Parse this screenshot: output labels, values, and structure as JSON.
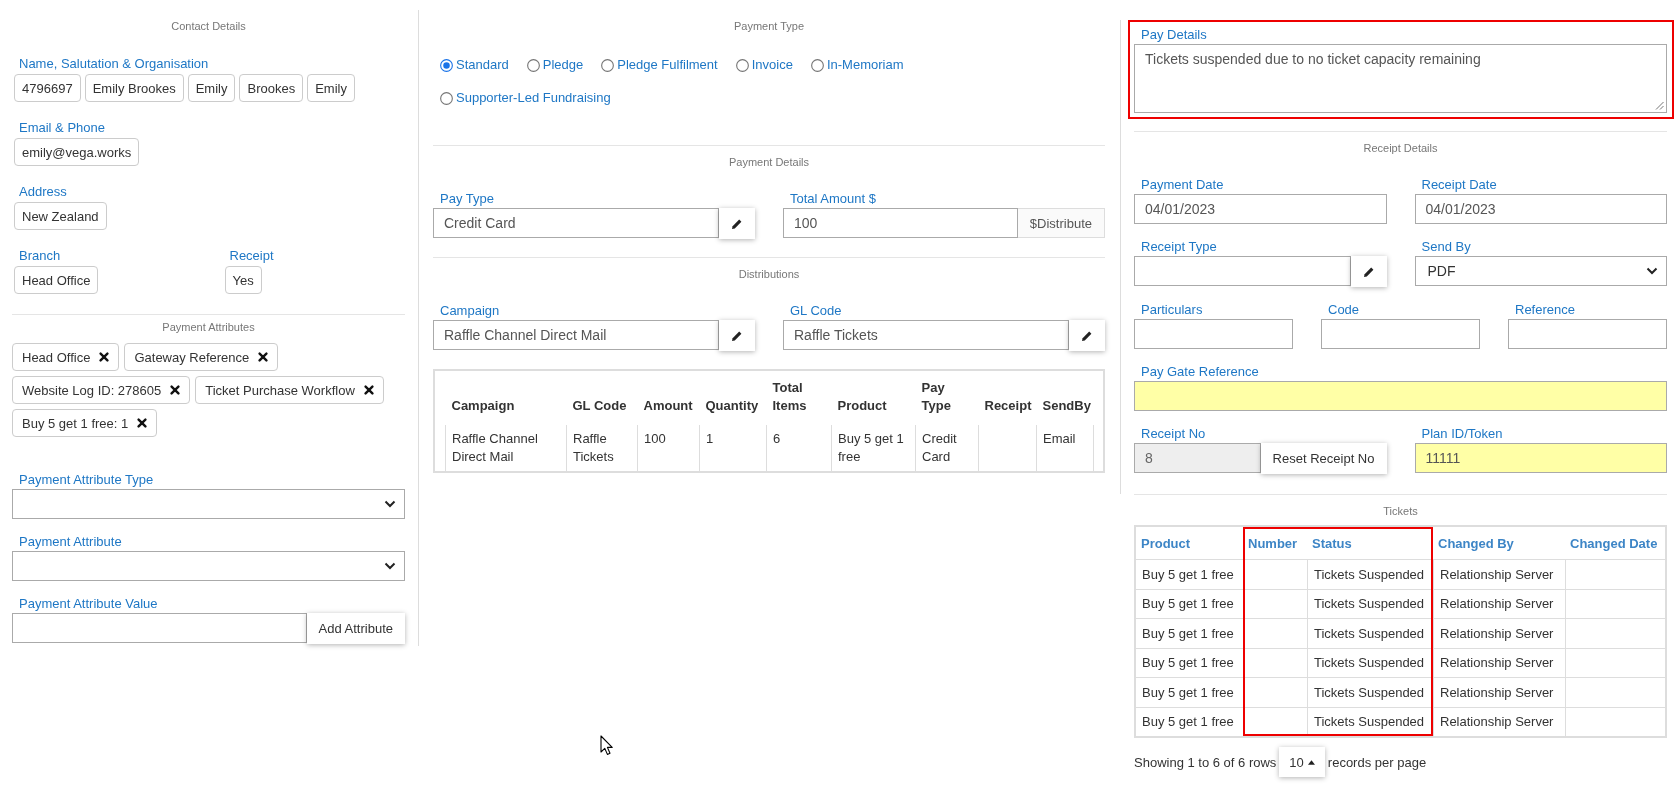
{
  "contact_details": {
    "title": "Contact Details",
    "rows": [
      [
        {
          "kind": "chips",
          "label": "Name, Salutation & Organisation",
          "values": [
            "4796697",
            "Emily Brookes",
            "Emily",
            "Brookes",
            "Emily"
          ]
        }
      ],
      [
        {
          "kind": "chips",
          "label": "Email & Phone",
          "values": [
            "emily@vega.works"
          ]
        }
      ],
      [
        {
          "kind": "chips",
          "label": "Address",
          "values": [
            "New Zealand"
          ]
        }
      ],
      [
        {
          "kind": "chips",
          "label": "Branch",
          "values": [
            "Head Office"
          ]
        },
        {
          "kind": "chips",
          "label": "Receipt",
          "values": [
            "Yes"
          ]
        }
      ]
    ]
  },
  "payment_attributes": {
    "title": "Payment Attributes",
    "tags": [
      "Head Office",
      "Gateway Reference",
      "Website Log ID: 278605",
      "Ticket Purchase Workflow",
      "Buy 5 get 1 free: 1"
    ],
    "rows": [
      [
        {
          "kind": "select",
          "label": "Payment Attribute Type"
        }
      ],
      [
        {
          "kind": "select",
          "label": "Payment Attribute"
        }
      ],
      [
        {
          "kind": "action",
          "label": "Payment Attribute Value",
          "button": "Add Attribute",
          "disabled": false
        }
      ]
    ]
  },
  "payment_type": {
    "title": "Payment Type",
    "options": [
      {
        "label": "Standard",
        "selected": true
      },
      {
        "label": "Pledge",
        "selected": false
      },
      {
        "label": "Pledge Fulfilment",
        "selected": false
      },
      {
        "label": "Invoice",
        "selected": false
      },
      {
        "label": "In-Memoriam",
        "selected": false
      },
      {
        "label": "Supporter-Led Fundraising",
        "selected": false
      }
    ]
  },
  "payment_details": {
    "title": "Payment Details",
    "rows": [
      [
        {
          "kind": "lookup",
          "label": "Pay Type",
          "value": "Credit Card"
        },
        {
          "kind": "addon",
          "label": "Total Amount $",
          "value": "100",
          "addon": "$Distribute"
        }
      ]
    ]
  },
  "distributions": {
    "title": "Distributions",
    "rows": [
      [
        {
          "kind": "lookup",
          "label": "Campaign",
          "value": "Raffle Channel Direct Mail"
        },
        {
          "kind": "lookup",
          "label": "GL Code",
          "value": "Raffle Tickets"
        }
      ]
    ],
    "table": {
      "kind": "summary",
      "columns": [
        "Campaign",
        "GL Code",
        "Amount",
        "Quantity",
        "Total Items",
        "Product",
        "Pay Type",
        "Receipt",
        "SendBy"
      ],
      "rows": [
        [
          "Raffle Channel Direct Mail",
          "Raffle Tickets",
          "100",
          "1",
          "6",
          "Buy 5 get 1 free",
          "Credit Card",
          null,
          "Email"
        ]
      ]
    }
  },
  "pay_details": {
    "highlighted": true,
    "rows": [
      [
        {
          "kind": "textarea",
          "label": "Pay Details",
          "value": "Tickets suspended due to no ticket capacity remaining"
        }
      ]
    ]
  },
  "receipt_details": {
    "title": "Receipt Details",
    "rows": [
      [
        {
          "kind": "text",
          "label": "Payment Date",
          "value": "04/01/2023"
        },
        {
          "kind": "text",
          "label": "Receipt Date",
          "value": "04/01/2023"
        }
      ],
      [
        {
          "kind": "lookup",
          "label": "Receipt Type"
        },
        {
          "kind": "select",
          "label": "Send By",
          "value": "PDF"
        }
      ],
      [
        {
          "kind": "text",
          "label": "Particulars"
        },
        {
          "kind": "text",
          "label": "Code"
        },
        {
          "kind": "text",
          "label": "Reference"
        }
      ],
      [
        {
          "kind": "highlight",
          "label": "Pay Gate Reference"
        }
      ],
      [
        {
          "kind": "action",
          "label": "Receipt No",
          "value": "8",
          "button": "Reset Receipt No",
          "disabled": true
        },
        {
          "kind": "highlight",
          "label": "Plan ID/Token",
          "value": "11111"
        }
      ]
    ]
  },
  "tickets": {
    "title": "Tickets",
    "table": {
      "kind": "list",
      "columns": [
        {
          "label": "Product",
          "highlighted": false
        },
        {
          "label": "Number",
          "highlighted": true
        },
        {
          "label": "Status",
          "highlighted": true
        },
        {
          "label": "Changed By",
          "highlighted": false
        },
        {
          "label": "Changed Date",
          "highlighted": false
        }
      ],
      "rows": [
        [
          "Buy 5 get 1 free",
          null,
          "Tickets Suspended",
          "Relationship Server",
          null
        ],
        [
          "Buy 5 get 1 free",
          null,
          "Tickets Suspended",
          "Relationship Server",
          null
        ],
        [
          "Buy 5 get 1 free",
          null,
          "Tickets Suspended",
          "Relationship Server",
          null
        ],
        [
          "Buy 5 get 1 free",
          null,
          "Tickets Suspended",
          "Relationship Server",
          null
        ],
        [
          "Buy 5 get 1 free",
          null,
          "Tickets Suspended",
          "Relationship Server",
          null
        ],
        [
          "Buy 5 get 1 free",
          null,
          "Tickets Suspended",
          "Relationship Server",
          null
        ]
      ]
    },
    "footer": {
      "summary": "Showing 1 to 6 of 6 rows",
      "page_size": "10",
      "suffix": "records per page"
    }
  }
}
